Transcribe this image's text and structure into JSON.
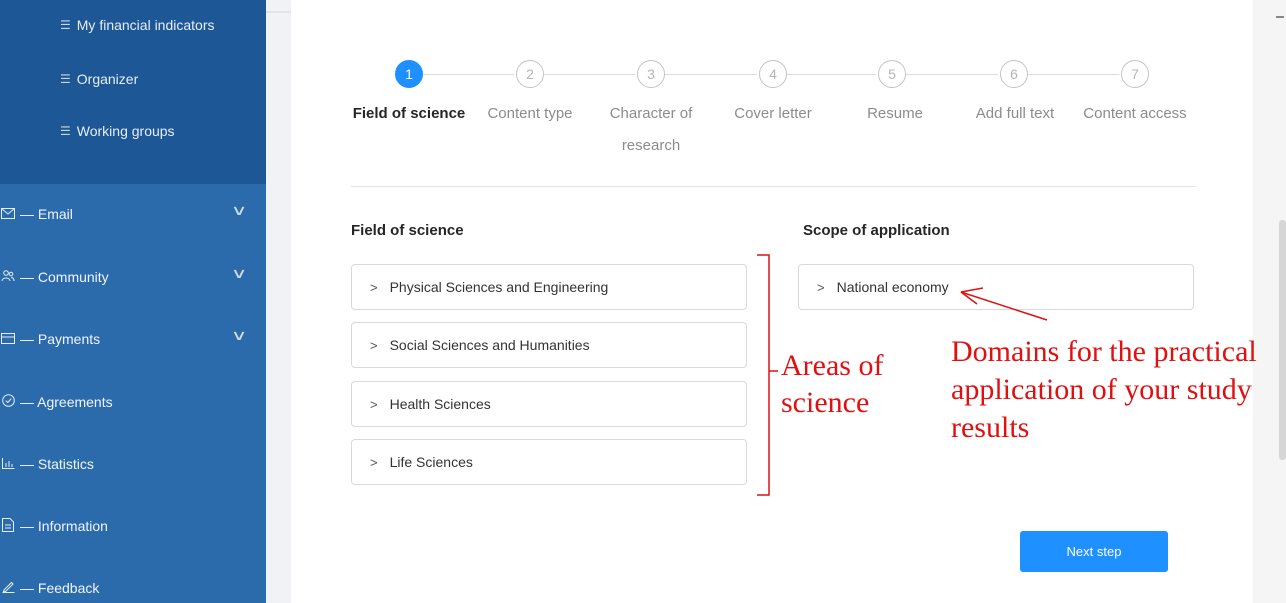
{
  "sidebar": {
    "sub_items": [
      {
        "label": "My financial indicators",
        "icon": "list-icon"
      },
      {
        "label": "Organizer",
        "icon": "list-icon"
      },
      {
        "label": "Working groups",
        "icon": "list-icon"
      }
    ],
    "items": [
      {
        "label": "— Email",
        "icon": "mail-icon",
        "expandable": true
      },
      {
        "label": "— Community",
        "icon": "community-icon",
        "expandable": true
      },
      {
        "label": "— Payments",
        "icon": "payment-card-icon",
        "expandable": true
      },
      {
        "label": "— Agreements",
        "icon": "check-circle-icon",
        "expandable": false
      },
      {
        "label": "— Statistics",
        "icon": "bar-chart-icon",
        "expandable": false
      },
      {
        "label": "— Information",
        "icon": "document-icon",
        "expandable": false
      },
      {
        "label": "— Feedback",
        "icon": "pencil-icon",
        "expandable": false
      }
    ]
  },
  "steps": [
    {
      "number": "1",
      "label": "Field of science",
      "active": true
    },
    {
      "number": "2",
      "label": "Content type",
      "active": false
    },
    {
      "number": "3",
      "label": "Character of research",
      "active": false
    },
    {
      "number": "4",
      "label": "Cover letter",
      "active": false
    },
    {
      "number": "5",
      "label": "Resume",
      "active": false
    },
    {
      "number": "6",
      "label": "Add full text",
      "active": false
    },
    {
      "number": "7",
      "label": "Content access",
      "active": false
    }
  ],
  "field_of_science": {
    "title": "Field of science",
    "items": [
      "Physical Sciences and Engineering",
      "Social Sciences and Humanities",
      "Health Sciences",
      "Life Sciences"
    ]
  },
  "scope_of_application": {
    "title": "Scope of application",
    "items": [
      "National economy"
    ]
  },
  "next_button": {
    "label": "Next step"
  },
  "annotations": {
    "areas_line1": "Areas of",
    "areas_line2": "science",
    "domains_line1": "Domains for the practical",
    "domains_line2": "application of your study",
    "domains_line3": "results",
    "color": "#e01010"
  },
  "colors": {
    "sidebar": "#2b6bab",
    "sidebar_submenu": "#1d5796",
    "accent": "#1e90ff"
  }
}
